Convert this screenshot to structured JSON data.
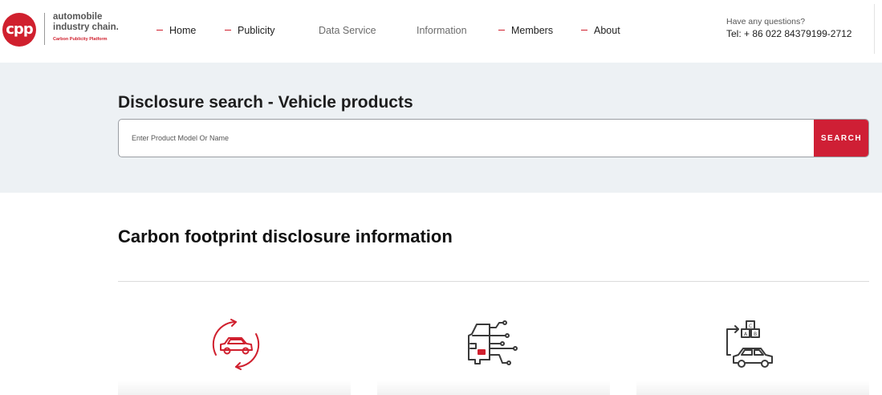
{
  "logo": {
    "mark": "cpp",
    "line1": "automobile",
    "line2": "industry chain.",
    "line3": "Carbon Publicity Platform",
    "brand_color": "#d0202e"
  },
  "nav": {
    "items": [
      {
        "label": "Home",
        "marker": true
      },
      {
        "label": "Publicity",
        "marker": true
      },
      {
        "label": "Data Service",
        "marker": false
      },
      {
        "label": "Information",
        "marker": false
      },
      {
        "label": "Members",
        "marker": true
      },
      {
        "label": "About",
        "marker": true
      }
    ]
  },
  "contact": {
    "question": "Have any questions?",
    "phone": "Tel: + 86 022 84379199-2712"
  },
  "search": {
    "title": "Disclosure search - Vehicle products",
    "placeholder": "Enter Product Model Or Name",
    "button_label": "SEARCH",
    "button_color": "#cf1f35"
  },
  "main": {
    "section_title": "Carbon footprint disclosure information",
    "cards": [
      {
        "icon": "car-cycle-icon"
      },
      {
        "icon": "car-circuit-icon"
      },
      {
        "icon": "car-parts-icon"
      }
    ]
  }
}
